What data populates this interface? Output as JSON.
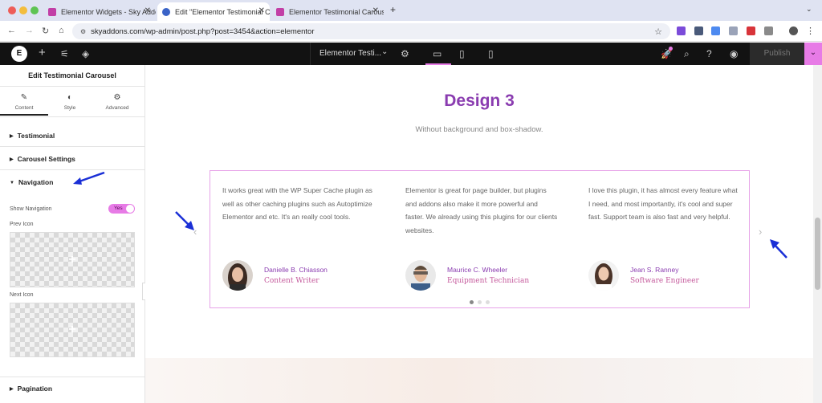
{
  "browser": {
    "tabs": [
      {
        "title": "Elementor Widgets - Sky Addo",
        "active": false
      },
      {
        "title": "Edit \"Elementor Testimonial C",
        "active": true
      },
      {
        "title": "Elementor Testimonial Carous",
        "active": false
      }
    ],
    "url": "skyaddons.com/wp-admin/post.php?post=3454&action=elementor"
  },
  "topbar": {
    "document_title": "Elementor Testi...",
    "publish_label": "Publish"
  },
  "panel": {
    "title": "Edit Testimonial Carousel",
    "tabs": [
      {
        "label": "Content",
        "icon": "pencil-icon"
      },
      {
        "label": "Style",
        "icon": "half-circle-icon"
      },
      {
        "label": "Advanced",
        "icon": "gear-icon"
      }
    ],
    "sections": {
      "testimonial": "Testimonial",
      "carousel_settings": "Carousel Settings",
      "navigation": "Navigation",
      "pagination": "Pagination"
    },
    "show_navigation_label": "Show Navigation",
    "show_navigation_value": "Yes",
    "prev_icon_label": "Prev Icon",
    "next_icon_label": "Next Icon"
  },
  "canvas": {
    "title": "Design 3",
    "subtitle": "Without background and box-shadow.",
    "testimonials": [
      {
        "quote": "It works great with the WP Super Cache plugin as well as other caching plugins such as Autoptimize Elementor and etc. It's an really cool tools.",
        "name": "Danielle B. Chiasson",
        "role": "Content Writer"
      },
      {
        "quote": "Elementor is great for page builder, but plugins and addons also make it more powerful and faster. We already using this plugins for our clients websites.",
        "name": "Maurice C. Wheeler",
        "role": "Equipment Technician"
      },
      {
        "quote": "I love this plugin, it has almost every feature what I need, and most importantly, it's cool and super fast. Support team is also fast and very helpful.",
        "name": "Jean S. Ranney",
        "role": "Software Engineer"
      }
    ]
  },
  "colors": {
    "accent_purple": "#8a3cb0",
    "role_pink": "#c4589b",
    "carousel_border": "#e7a3e8",
    "toggle_on": "#e77be6",
    "publish_accent": "#e77be6",
    "annotation_arrow": "#1a2fd6"
  }
}
